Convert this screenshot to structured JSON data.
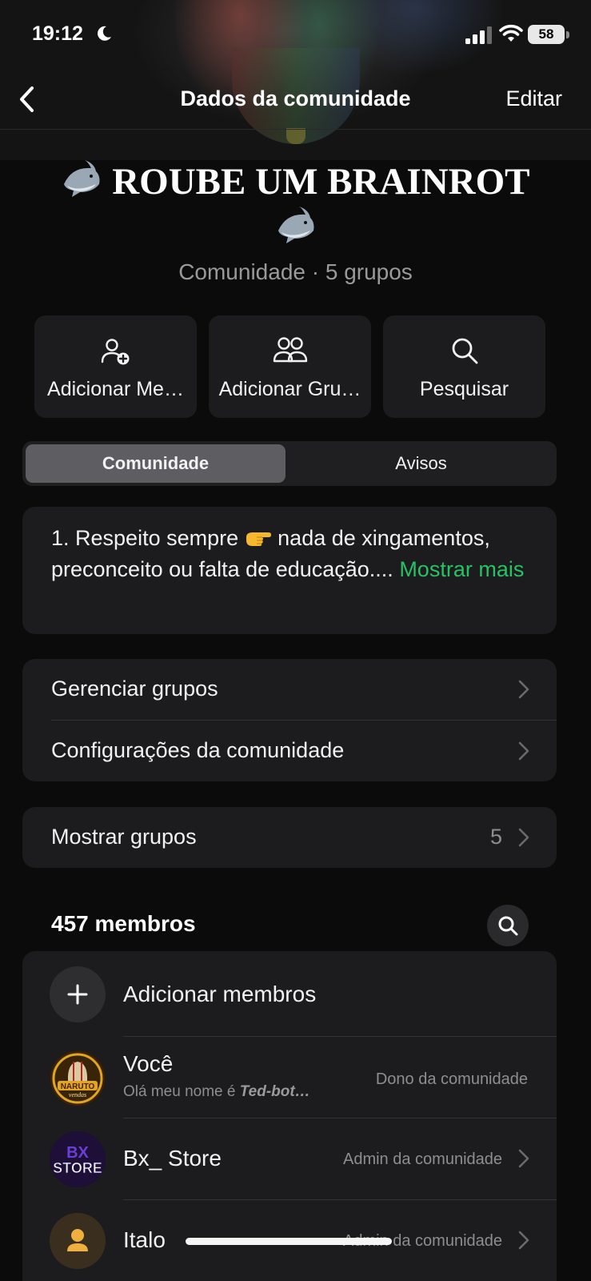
{
  "status_bar": {
    "time": "19:12",
    "battery": "58"
  },
  "nav": {
    "title": "Dados da comunidade",
    "edit_label": "Editar"
  },
  "community": {
    "name": "ROUBE UM BRAINROT",
    "subtitle": "Comunidade · 5 grupos"
  },
  "actions": [
    {
      "label": "Adicionar Me…",
      "icon": "add-person-icon"
    },
    {
      "label": "Adicionar Gru…",
      "icon": "group-icon"
    },
    {
      "label": "Pesquisar",
      "icon": "search-icon"
    }
  ],
  "tabs": {
    "community": "Comunidade",
    "announcements": "Avisos",
    "active": "Comunidade"
  },
  "description": {
    "text_before": "1. Respeito sempre",
    "text_after": "nada de xingamentos, preconceito ou falta de educação....",
    "more_label": "Mostrar mais"
  },
  "settings": {
    "manage_groups": "Gerenciar grupos",
    "community_settings": "Configurações da comunidade"
  },
  "groups_row": {
    "label": "Mostrar grupos",
    "count": "5"
  },
  "members": {
    "header": "457 membros",
    "add_label": "Adicionar membros",
    "list": [
      {
        "name": "Você",
        "status_prefix": "Olá meu nome é ",
        "status_bold": "Ted-bot…",
        "role": "Dono da comunidade",
        "avatar_text_1": "NARUTO",
        "avatar_text_2": "vendas"
      },
      {
        "name": "Bx_ Store",
        "role": "Admin da comunidade",
        "avatar_text_1": "BX",
        "avatar_text_2": "STORE"
      },
      {
        "name": "Italo",
        "role": "Admin da comunidade"
      }
    ]
  },
  "colors": {
    "accent_green": "#27c263",
    "card_bg": "#1c1c1e",
    "page_bg": "#0b0b0b"
  }
}
